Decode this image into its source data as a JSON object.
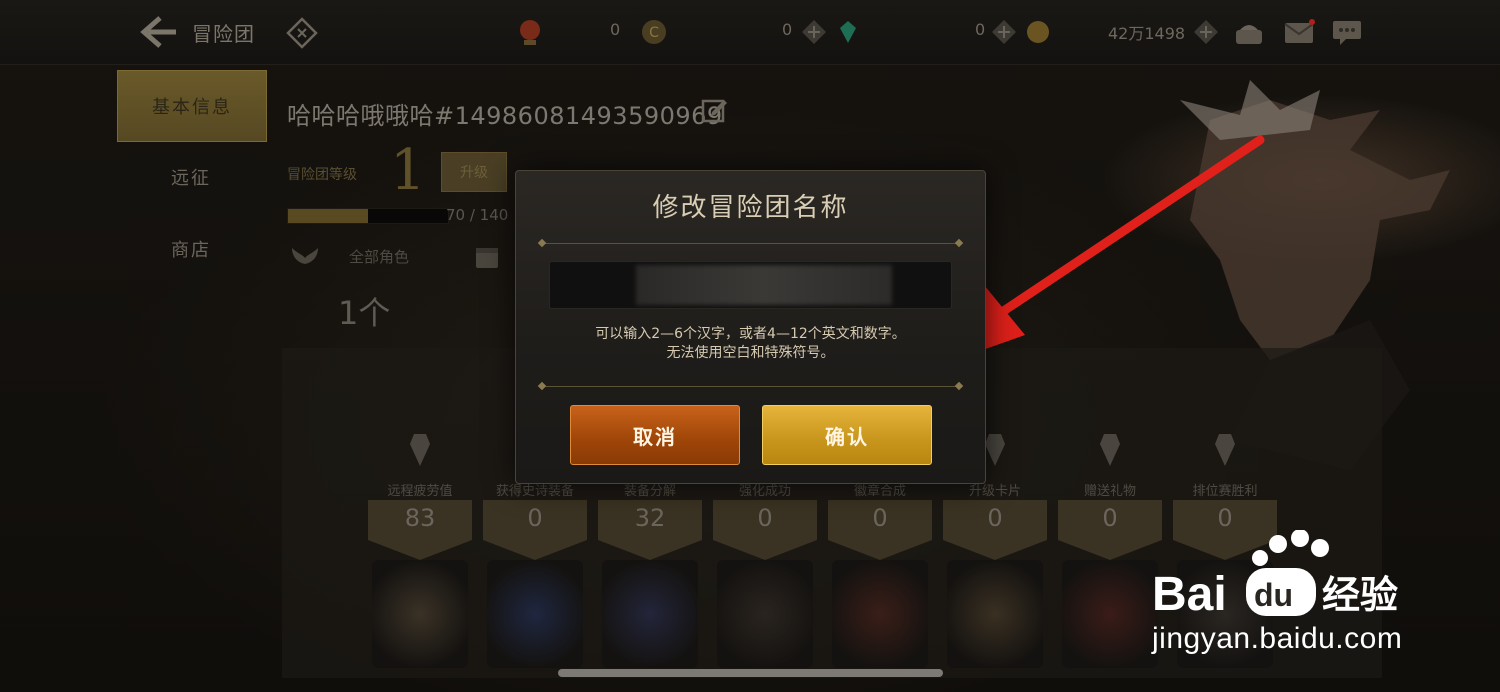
{
  "header": {
    "title": "冒险团",
    "currencies": [
      "0",
      "0",
      "0",
      "42万1498"
    ]
  },
  "nav": {
    "items": [
      "基本信息",
      "远征",
      "商店"
    ]
  },
  "profile": {
    "name": "哈哈哈哦哦哈#14986081493590969",
    "level_label": "冒险团等级",
    "level": "1",
    "upgrade_label": "升级",
    "progress_text": "70 / 140",
    "progress_fraction": 0.5,
    "filter_label": "全部角色",
    "count": "1个"
  },
  "stats": [
    {
      "label": "远程疲劳值",
      "value": "83"
    },
    {
      "label": "获得史诗装备",
      "value": "0"
    },
    {
      "label": "装备分解",
      "value": "32"
    },
    {
      "label": "强化成功",
      "value": "0"
    },
    {
      "label": "徽章合成",
      "value": "0"
    },
    {
      "label": "升级卡片",
      "value": "0"
    },
    {
      "label": "赠送礼物",
      "value": "0"
    },
    {
      "label": "排位赛胜利",
      "value": "0"
    }
  ],
  "modal": {
    "title": "修改冒险团名称",
    "hint_line1": "可以输入2—6个汉字，或者4—12个英文和数字。",
    "hint_line2": "无法使用空白和特殊符号。",
    "cancel_label": "取消",
    "confirm_label": "确认"
  },
  "watermark": {
    "logo_text": "Bai du 经验",
    "url": "jingyan.baidu.com"
  },
  "colors": {
    "cancel": "#a8480a",
    "confirm": "#d4a02a",
    "arrow": "#e0201a"
  }
}
